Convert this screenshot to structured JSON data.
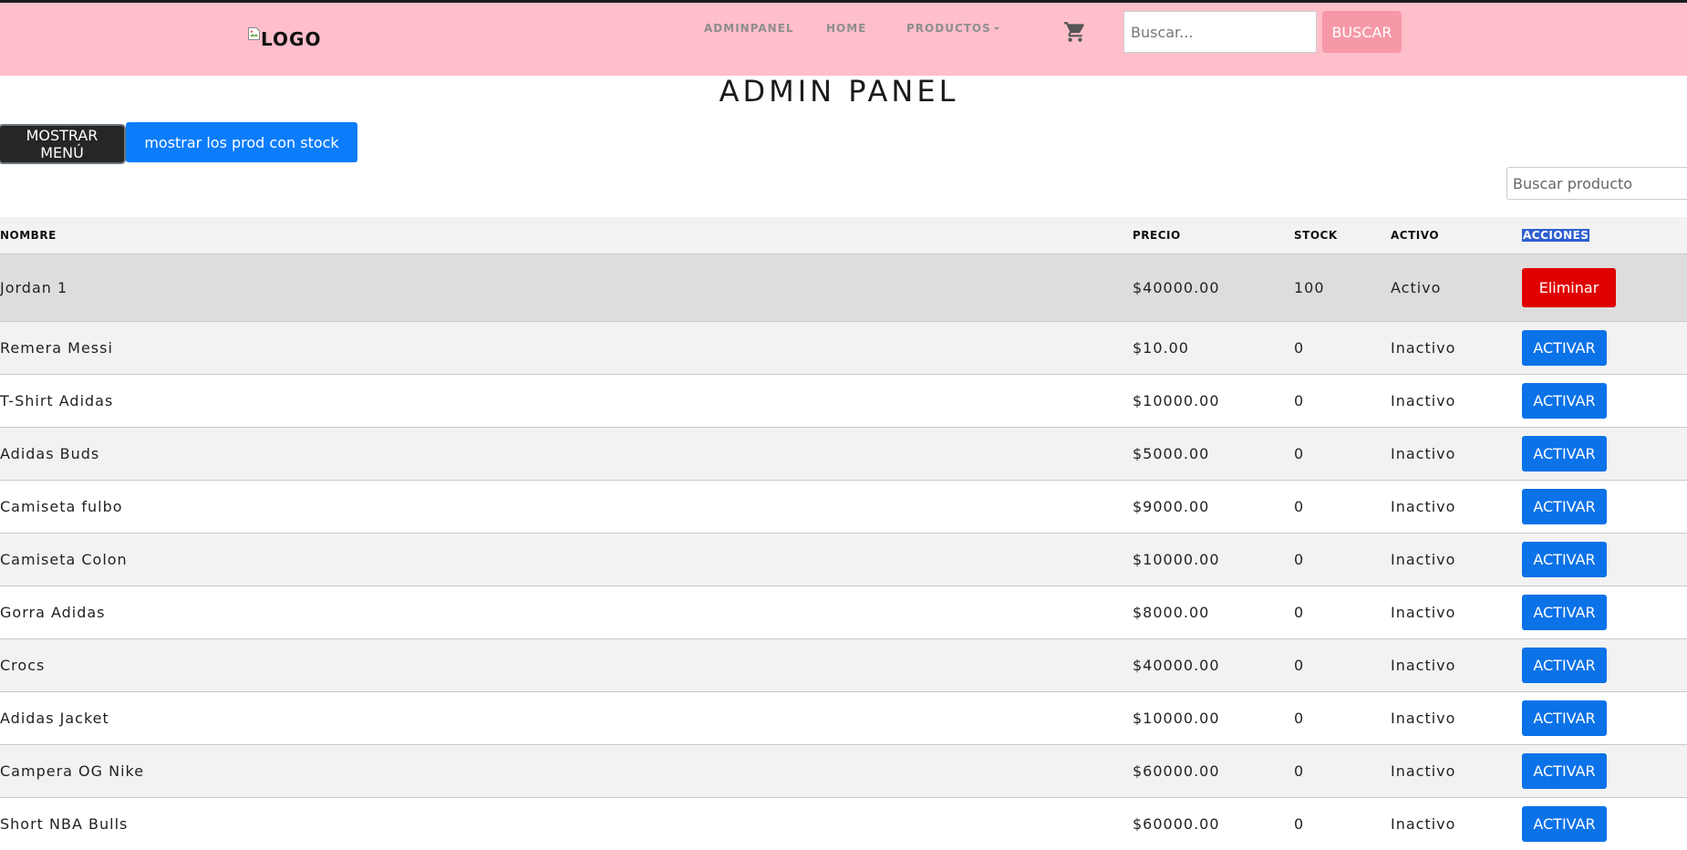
{
  "navbar": {
    "logo_alt": "LOGO",
    "links": [
      {
        "label": "ADMINPANEL"
      },
      {
        "label": "HOME"
      },
      {
        "label": "PRODUCTOS"
      }
    ],
    "search_placeholder": "Buscar...",
    "search_button": "BUSCAR",
    "cart_icon": "shopping-cart-icon"
  },
  "page_title": "ADMIN PANEL",
  "controls": {
    "menu_button": "MOSTRAR MENÚ",
    "stock_button": "mostrar los prod con stock",
    "filter_placeholder": "Buscar producto"
  },
  "table": {
    "headers": {
      "nombre": "NOMBRE",
      "precio": "PRECIO",
      "stock": "STOCK",
      "activo": "ACTIVO",
      "acciones": "ACCIONES"
    },
    "rows": [
      {
        "nombre": "Jordan 1",
        "precio": "$40000.00",
        "stock": "100",
        "activo": "Activo",
        "accion": "Eliminar"
      },
      {
        "nombre": "Remera Messi",
        "precio": "$10.00",
        "stock": "0",
        "activo": "Inactivo",
        "accion": "ACTIVAR"
      },
      {
        "nombre": "T-Shirt Adidas",
        "precio": "$10000.00",
        "stock": "0",
        "activo": "Inactivo",
        "accion": "ACTIVAR"
      },
      {
        "nombre": "Adidas Buds",
        "precio": "$5000.00",
        "stock": "0",
        "activo": "Inactivo",
        "accion": "ACTIVAR"
      },
      {
        "nombre": "Camiseta fulbo",
        "precio": "$9000.00",
        "stock": "0",
        "activo": "Inactivo",
        "accion": "ACTIVAR"
      },
      {
        "nombre": "Camiseta Colon",
        "precio": "$10000.00",
        "stock": "0",
        "activo": "Inactivo",
        "accion": "ACTIVAR"
      },
      {
        "nombre": "Gorra Adidas",
        "precio": "$8000.00",
        "stock": "0",
        "activo": "Inactivo",
        "accion": "ACTIVAR"
      },
      {
        "nombre": "Crocs",
        "precio": "$40000.00",
        "stock": "0",
        "activo": "Inactivo",
        "accion": "ACTIVAR"
      },
      {
        "nombre": "Adidas Jacket",
        "precio": "$10000.00",
        "stock": "0",
        "activo": "Inactivo",
        "accion": "ACTIVAR"
      },
      {
        "nombre": "Campera OG Nike",
        "precio": "$60000.00",
        "stock": "0",
        "activo": "Inactivo",
        "accion": "ACTIVAR"
      },
      {
        "nombre": "Short NBA Bulls",
        "precio": "$60000.00",
        "stock": "0",
        "activo": "Inactivo",
        "accion": "ACTIVAR"
      }
    ]
  },
  "colors": {
    "navbar_bg": "#ffbfca",
    "search_button_bg": "#f698a8",
    "primary_blue": "#0b7dfb",
    "danger_red": "#e00000"
  }
}
